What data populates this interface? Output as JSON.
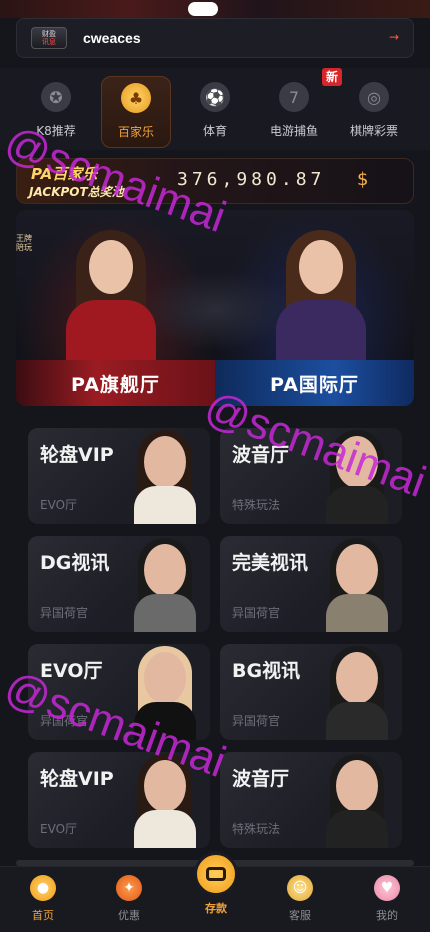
{
  "notice": {
    "badge_top": "财盈",
    "badge_bottom": "讯息",
    "text": "cweaces",
    "arrow": "→"
  },
  "categories": [
    {
      "label": "K8推荐",
      "icon": "medal-icon",
      "active": false
    },
    {
      "label": "百家乐",
      "icon": "baccarat-icon",
      "active": true
    },
    {
      "label": "体育",
      "icon": "soccer-ball-icon",
      "active": false
    },
    {
      "label": "电游捕鱼",
      "icon": "slot-seven-icon",
      "active": false
    },
    {
      "label": "棋牌彩票",
      "icon": "chip-icon",
      "active": false
    }
  ],
  "new_badge": "新",
  "jackpot": {
    "title": "PA百家乐",
    "subtitle": "JACKPOT总奖池",
    "amount": "376,980.87",
    "currency": "$"
  },
  "hero": {
    "side_tag": "王牌 陪玩",
    "left_button": "PA旗舰厅",
    "right_button": "PA国际厅"
  },
  "games": [
    {
      "title": "轮盘VIP",
      "sub": "EVO厅"
    },
    {
      "title": "波音厅",
      "sub": "特殊玩法"
    },
    {
      "title": "DG视讯",
      "sub": "异国荷官"
    },
    {
      "title": "完美视讯",
      "sub": "异国荷官"
    },
    {
      "title": "EVO厅",
      "sub": "异国荷官"
    },
    {
      "title": "BG视讯",
      "sub": "异国荷官"
    },
    {
      "title": "轮盘VIP",
      "sub": "EVO厅"
    },
    {
      "title": "波音厅",
      "sub": "特殊玩法"
    }
  ],
  "nav": {
    "home": "首页",
    "promo": "优惠",
    "deposit": "存款",
    "service": "客服",
    "mine": "我的"
  },
  "watermark": "@scmaimai",
  "colors": {
    "accent": "#f0a23a",
    "red_hall": "#9a1c22",
    "blue_hall": "#1c4fa0",
    "watermark": "#c628d6"
  }
}
